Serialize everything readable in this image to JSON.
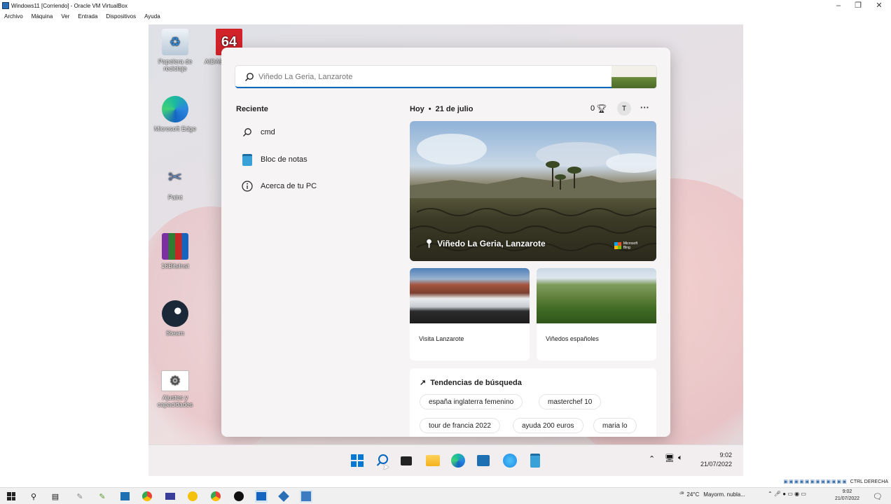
{
  "host": {
    "title": "Windows11 [Corriendo] - Oracle VM VirtualBox",
    "menu": [
      "Archivo",
      "Máquina",
      "Ver",
      "Entrada",
      "Dispositivos",
      "Ayuda"
    ],
    "status_key": "CTRL DERECHA"
  },
  "desktop": {
    "icons": [
      {
        "label": "Papelera de reciclaje"
      },
      {
        "label": "AIDA64"
      },
      {
        "label": "Microsoft Edge"
      },
      {
        "label": "Paint"
      },
      {
        "label": "16BitsInst"
      },
      {
        "label": "Steam"
      },
      {
        "label": "Ajustes y capacidades"
      }
    ]
  },
  "search": {
    "placeholder": "Viñedo La Geria, Lanzarote",
    "recent_title": "Reciente",
    "recent": [
      {
        "label": "cmd",
        "icon": "search-icon"
      },
      {
        "label": "Bloc de notas",
        "icon": "notepad-icon"
      },
      {
        "label": "Acerca de tu PC",
        "icon": "info-icon"
      }
    ],
    "today": "Hoy",
    "date": "21 de julio",
    "points": "0",
    "avatar": "T",
    "more": "···",
    "hero_caption": "Viñedo La Geria, Lanzarote",
    "hero_brand": "Microsoft Bing",
    "cards": [
      {
        "label": "Visita Lanzarote"
      },
      {
        "label": "Viñedos españoles"
      }
    ],
    "trends_title": "Tendencias de búsqueda",
    "trends": [
      "españa inglaterra femenino",
      "masterchef 10",
      "tour de francia 2022",
      "ayuda 200 euros",
      "maria lo"
    ]
  },
  "vm_taskbar": {
    "time": "9:02",
    "date": "21/07/2022"
  },
  "host_taskbar": {
    "weather_temp": "24°C",
    "weather_text": "Mayorm. nubla...",
    "time": "9:02",
    "date": "21/07/2022"
  },
  "colors": {
    "accent": "#0067c0",
    "vm_bg": "#e6e0e3",
    "start_bg": "#f6f4f5"
  }
}
